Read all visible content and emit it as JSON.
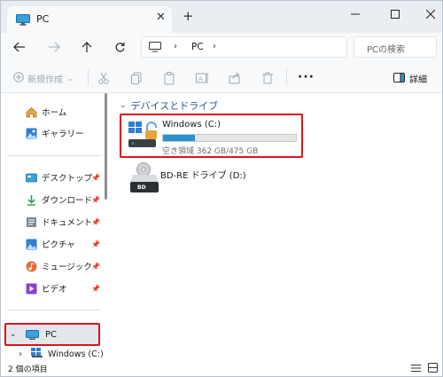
{
  "tab": {
    "title": "PC"
  },
  "address": {
    "segment": "PC"
  },
  "search": {
    "placeholder": "PCの検索"
  },
  "toolbar": {
    "new_label": "新規作成",
    "details_label": "詳細"
  },
  "sidebar": {
    "home": "ホーム",
    "gallery": "ギャラリー",
    "quick": [
      {
        "label": "デスクトップ",
        "icon": "desktop-icon"
      },
      {
        "label": "ダウンロード",
        "icon": "download-icon"
      },
      {
        "label": "ドキュメント",
        "icon": "documents-icon"
      },
      {
        "label": "ピクチャ",
        "icon": "pictures-icon"
      },
      {
        "label": "ミュージック",
        "icon": "music-icon"
      },
      {
        "label": "ビデオ",
        "icon": "videos-icon"
      }
    ],
    "pc": "PC",
    "pc_child": "Windows (C:)"
  },
  "main": {
    "group_title": "デバイスとドライブ",
    "drive_c": {
      "name": "Windows (C:)",
      "free": "空き領域 362 GB/475 GB",
      "used_fraction": 0.24
    },
    "drive_d": {
      "name": "BD-RE ドライブ (D:)",
      "badge": "BD"
    }
  },
  "status": {
    "item_count": "2 個の項目"
  },
  "colors": {
    "accent": "#2b91d1",
    "highlight": "#e0121b",
    "group_header": "#2b5797"
  }
}
